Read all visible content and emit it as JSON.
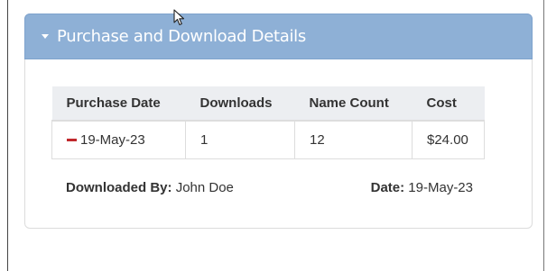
{
  "panel": {
    "title": "Purchase and Download Details",
    "header_color": "#8eb0d6"
  },
  "table": {
    "headers": [
      "Purchase Date",
      "Downloads",
      "Name Count",
      "Cost"
    ],
    "rows": [
      {
        "purchase_date": "19-May-23",
        "downloads": "1",
        "name_count": "12",
        "cost": "$24.00"
      }
    ],
    "collapse_icon_color": "#c0282c"
  },
  "footer": {
    "downloaded_by_label": "Downloaded By:",
    "downloaded_by_value": "John Doe",
    "date_label": "Date:",
    "date_value": "19-May-23"
  },
  "icons": {
    "panel_toggle": "caret-down-icon",
    "row_toggle": "minus-icon",
    "pointer": "mouse-cursor-icon"
  }
}
